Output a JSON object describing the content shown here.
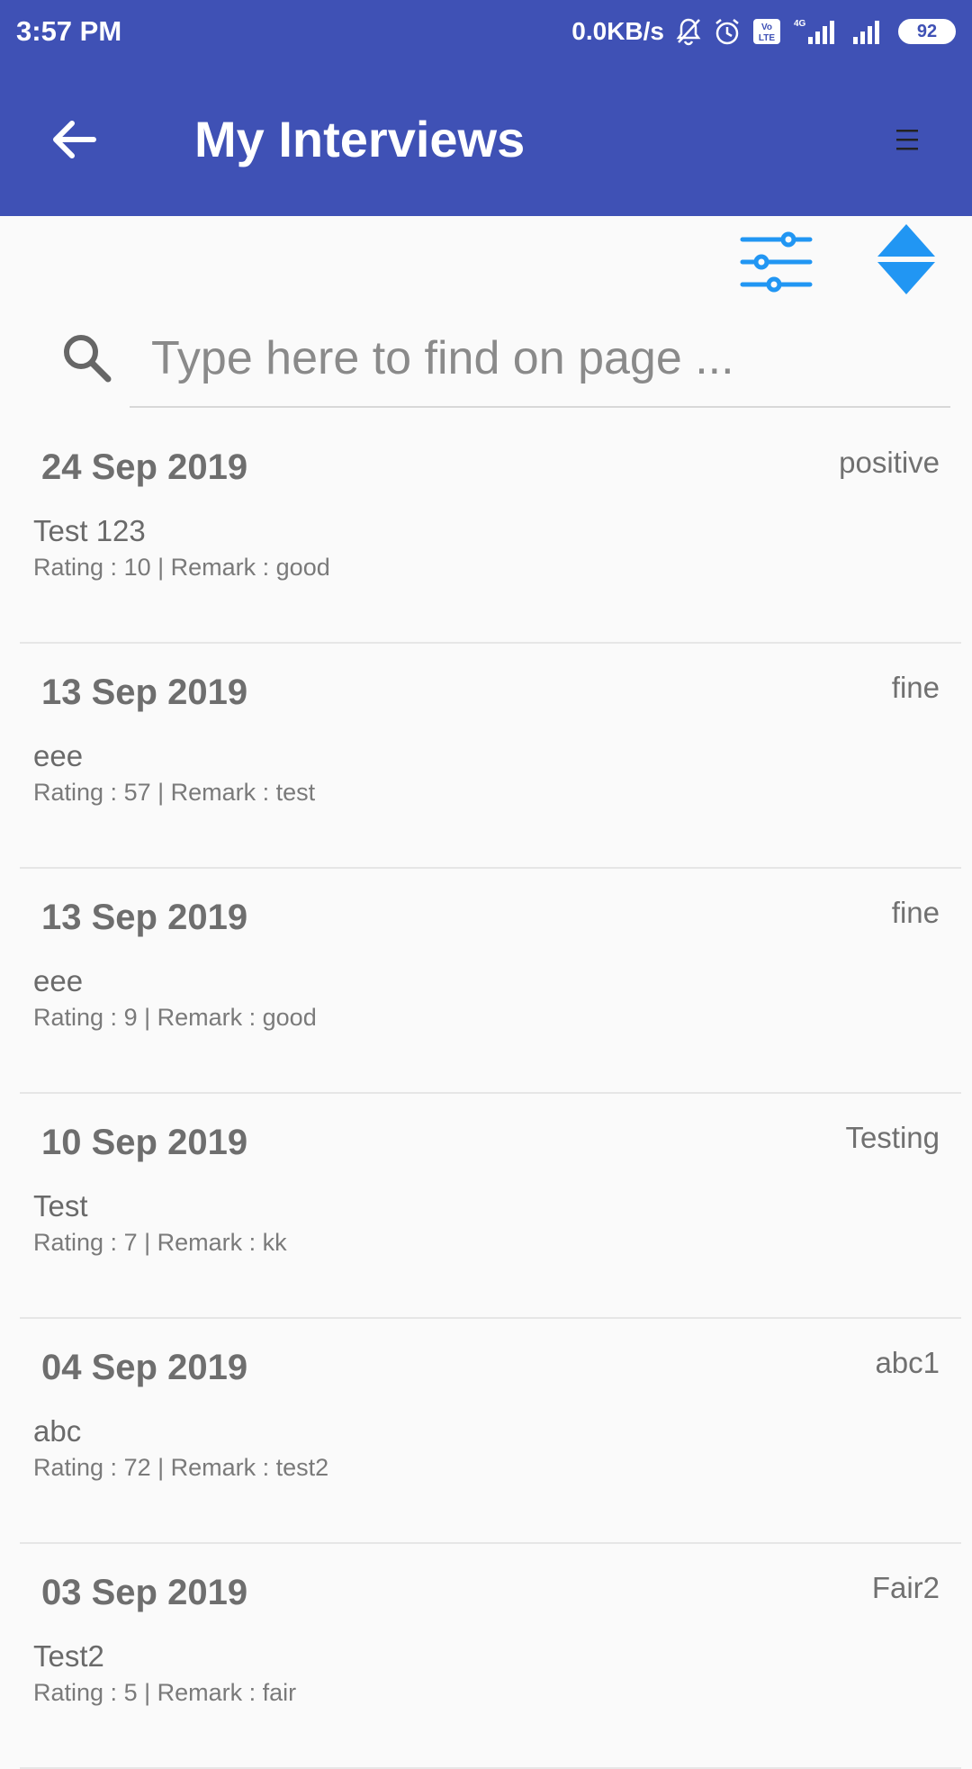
{
  "status_bar": {
    "time": "3:57 PM",
    "network_speed": "0.0KB/s",
    "network_type": "4G",
    "volte_label": "Vo LTE",
    "battery": "92"
  },
  "app_bar": {
    "title": "My Interviews"
  },
  "search": {
    "placeholder": "Type here to find on page ..."
  },
  "interviews": [
    {
      "date": "24 Sep 2019",
      "tag": "positive",
      "name": "Test 123",
      "rating": "10",
      "remark": "good"
    },
    {
      "date": "13 Sep 2019",
      "tag": "fine",
      "name": "eee",
      "rating": "57",
      "remark": "test"
    },
    {
      "date": "13 Sep 2019",
      "tag": "fine",
      "name": "eee",
      "rating": "9",
      "remark": "good"
    },
    {
      "date": "10 Sep 2019",
      "tag": "Testing",
      "name": "Test",
      "rating": "7",
      "remark": "kk"
    },
    {
      "date": "04 Sep 2019",
      "tag": "abc1",
      "name": "abc",
      "rating": "72",
      "remark": "test2"
    },
    {
      "date": "03 Sep 2019",
      "tag": "Fair2",
      "name": "Test2",
      "rating": "5",
      "remark": "fair"
    }
  ],
  "labels": {
    "rating_prefix": "Rating : ",
    "remark_prefix": " | Remark : "
  },
  "colors": {
    "primary": "#3f51b5",
    "accent_icon": "#2196f3",
    "background": "#fafafa"
  }
}
